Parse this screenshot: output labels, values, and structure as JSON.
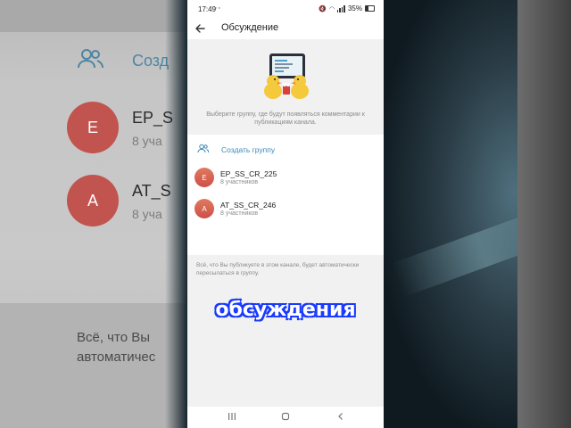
{
  "status": {
    "time": "17:49",
    "battery": "35%"
  },
  "appbar": {
    "title": "Обсуждение"
  },
  "header": {
    "hint": "Выберите группу, где будут появляться комментарии к публикациям канала."
  },
  "create_group": {
    "label": "Создать группу"
  },
  "chats": [
    {
      "initial": "E",
      "name": "EP_SS_CR_225",
      "members": "8 участников"
    },
    {
      "initial": "A",
      "name": "AT_SS_CR_246",
      "members": "8 участников"
    }
  ],
  "footer": {
    "text": "Всё, что Вы публикуете в этом канале, будет автоматически пересылаться в группу."
  },
  "background": {
    "create_label": "Созд",
    "chat1_name": "EP_S",
    "chat1_sub": "8 уча",
    "chat2_name": "AT_S",
    "chat2_sub": "8 уча",
    "bottom_line1": "Всё, что Вы",
    "bottom_line2": "автоматичес"
  },
  "caption": "обсуждения",
  "colors": {
    "accent": "#3f87b8",
    "avatar": "#cd4f49",
    "caption_outline": "#1a3bff"
  }
}
